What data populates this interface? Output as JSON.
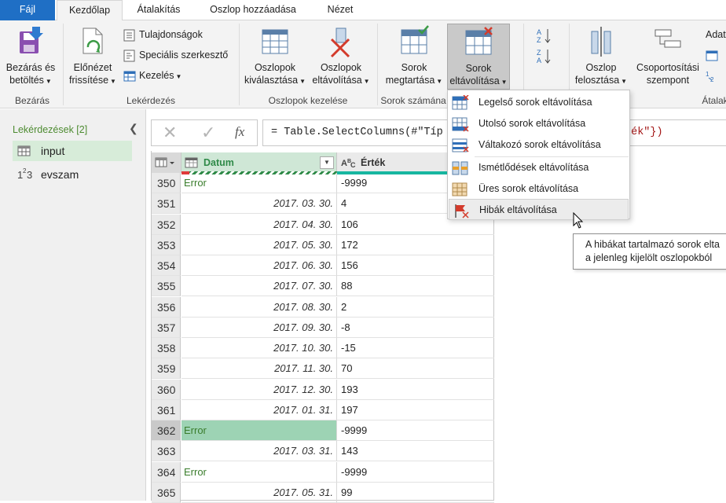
{
  "tabs": [
    "Fájl",
    "Kezdőlap",
    "Átalakítás",
    "Oszlop hozzáadása",
    "Nézet"
  ],
  "ribbon": {
    "close": {
      "l1": "Bezárás és",
      "l2": "betöltés",
      "group": "Bezárás"
    },
    "query": {
      "refresh": {
        "l1": "Előnézet",
        "l2": "frissítése"
      },
      "properties": "Tulajdonságok",
      "advanced_editor": "Speciális szerkesztő",
      "manage": "Kezelés",
      "group": "Lekérdezés"
    },
    "columns": {
      "choose": {
        "l1": "Oszlopok",
        "l2": "kiválasztása"
      },
      "remove": {
        "l1": "Oszlopok",
        "l2": "eltávolítása"
      },
      "group": "Oszlopok kezelése"
    },
    "rows": {
      "keep": {
        "l1": "Sorok",
        "l2": "megtartása"
      },
      "remove": {
        "l1": "Sorok",
        "l2": "eltávolítása"
      },
      "group": "Sorok számána"
    },
    "transform": {
      "split": {
        "l1": "Oszlop",
        "l2": "felosztása"
      },
      "groupby": {
        "l1": "Csoportosítási",
        "l2": "szempont"
      },
      "datatype": "Adat",
      "group": "Átalak"
    }
  },
  "queries": {
    "title": "Lekérdezések [2]",
    "items": [
      {
        "name": "input",
        "icon": "table-icon"
      },
      {
        "name": "evszam",
        "icon": "number-icon"
      }
    ]
  },
  "formula": {
    "fx": "fx",
    "text_start": "= Table.SelectColumns(#\"Típ",
    "text_end": "ték\"})"
  },
  "grid": {
    "columns": [
      "Datum",
      "Érték"
    ],
    "rows": [
      {
        "n": "350",
        "d": "Error",
        "v": "-9999",
        "err": true
      },
      {
        "n": "351",
        "d": "2017. 03. 30.",
        "v": "4"
      },
      {
        "n": "352",
        "d": "2017. 04. 30.",
        "v": "106"
      },
      {
        "n": "353",
        "d": "2017. 05. 30.",
        "v": "172"
      },
      {
        "n": "354",
        "d": "2017. 06. 30.",
        "v": "156"
      },
      {
        "n": "355",
        "d": "2017. 07. 30.",
        "v": "88"
      },
      {
        "n": "356",
        "d": "2017. 08. 30.",
        "v": "2"
      },
      {
        "n": "357",
        "d": "2017. 09. 30.",
        "v": "-8"
      },
      {
        "n": "358",
        "d": "2017. 10. 30.",
        "v": "-15"
      },
      {
        "n": "359",
        "d": "2017. 11. 30.",
        "v": "70"
      },
      {
        "n": "360",
        "d": "2017. 12. 30.",
        "v": "193"
      },
      {
        "n": "361",
        "d": "2017. 01. 31.",
        "v": "197"
      },
      {
        "n": "362",
        "d": "Error",
        "v": "-9999",
        "err": true,
        "sel": true
      },
      {
        "n": "363",
        "d": "2017. 03. 31.",
        "v": "143"
      },
      {
        "n": "364",
        "d": "Error",
        "v": "-9999",
        "err": true
      },
      {
        "n": "365",
        "d": "2017. 05. 31.",
        "v": "99"
      }
    ]
  },
  "menu": {
    "items": [
      "Legelső sorok eltávolítása",
      "Utolsó sorok eltávolítása",
      "Váltakozó sorok eltávolítása",
      "Ismétlődések eltávolítása",
      "Üres sorok eltávolítása",
      "Hibák eltávolítása"
    ],
    "highlighted": "Hibák eltávolítása"
  },
  "tooltip": {
    "line1": "A hibákat tartalmazó sorok elta",
    "line2": "a jelenleg kijelölt oszlopokból"
  },
  "colors": {
    "file_tab": "#1f6fc5",
    "error_text": "#3a7d2c",
    "selected_error_cell": "#9dd3b4",
    "query_title": "#4d8b31"
  }
}
